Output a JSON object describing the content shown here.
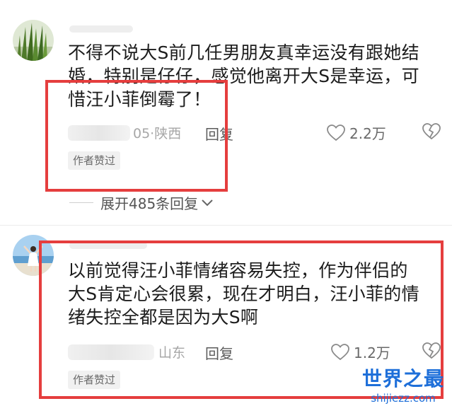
{
  "comments": [
    {
      "text_lines": [
        "不得不说大S前几任男朋友真幸运没有跟她结",
        "婚，特别是仔仔，感觉他离开大S是幸运，可",
        "惜汪小菲倒霉了！"
      ],
      "location": "05·陕西",
      "reply_label": "回复",
      "likes": "2.2万",
      "badge": "作者赞过",
      "avatar_icon": "grass-icon"
    },
    {
      "text_lines": [
        "以前觉得汪小菲情绪容易失控，作为伴侣的",
        "大S肯定心会很累，现在才明白，汪小菲的情",
        "绪失控全都是因为大S啊"
      ],
      "location": "山东",
      "reply_label": "回复",
      "likes": "1.2万",
      "badge": "作者赞过",
      "avatar_icon": "person-beach-icon"
    }
  ],
  "expand_replies": "展开485条回复",
  "watermark": {
    "title": "世界之最",
    "url": "shijiezz.com"
  },
  "colors": {
    "highlight": "#e53e3e",
    "watermark": "#1e6fd9"
  }
}
